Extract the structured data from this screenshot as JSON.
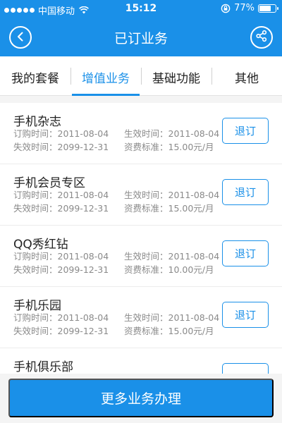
{
  "status_bar": {
    "carrier": "中国移动",
    "time": "15:12",
    "battery_percent": "77%",
    "battery_level": 0.77,
    "signal_icon": "signal-dots-icon",
    "wifi_icon": "wifi-icon",
    "rotation_lock_icon": "rotation-lock-icon"
  },
  "nav": {
    "title": "已订业务",
    "back_icon": "back-arrow-icon",
    "share_icon": "share-icon"
  },
  "tabs": [
    {
      "label": "我的套餐",
      "active": false
    },
    {
      "label": "增值业务",
      "active": true
    },
    {
      "label": "基础功能",
      "active": false
    },
    {
      "label": "其他",
      "active": false
    }
  ],
  "services": [
    {
      "name": "手机杂志",
      "order_time": "订购时间：2011-08-04",
      "effective_time": "生效时间：2011-08-04",
      "expire_time": "失效时间：2099-12-31",
      "fee": "资费标准：15.00元/月",
      "cancel_label": "退订"
    },
    {
      "name": "手机会员专区",
      "order_time": "订购时间：2011-08-04",
      "effective_time": "生效时间：2011-08-04",
      "expire_time": "失效时间：2099-12-31",
      "fee": "资费标准：15.00元/月",
      "cancel_label": "退订"
    },
    {
      "name": "QQ秀红钻",
      "order_time": "订购时间：2011-08-04",
      "effective_time": "生效时间：2011-08-04",
      "expire_time": "失效时间：2099-12-31",
      "fee": "资费标准：10.00元/月",
      "cancel_label": "退订"
    },
    {
      "name": "手机乐园",
      "order_time": "订购时间：2011-08-04",
      "effective_time": "生效时间：2011-08-04",
      "expire_time": "失效时间：2099-12-31",
      "fee": "资费标准：15.00元/月",
      "cancel_label": "退订"
    },
    {
      "name": "手机俱乐部",
      "order_time": "",
      "effective_time": "",
      "expire_time": "",
      "fee": "",
      "cancel_label": ""
    }
  ],
  "bottom": {
    "more_label": "更多业务办理"
  },
  "colors": {
    "primary": "#1a90e8",
    "background": "#f4f4f4",
    "meta_text": "#8a8a8a"
  }
}
